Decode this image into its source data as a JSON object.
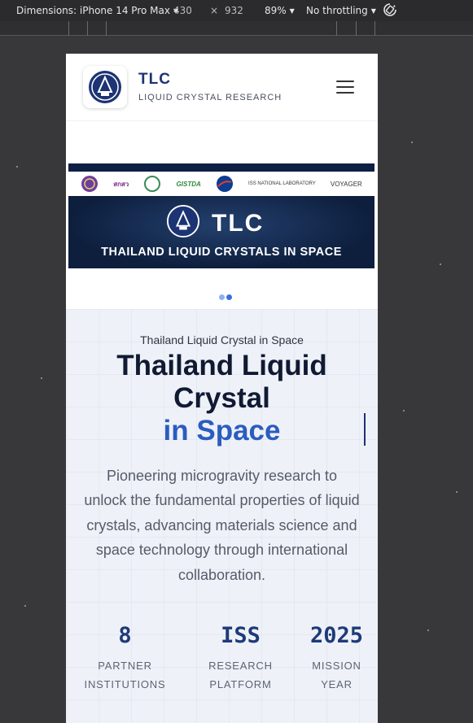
{
  "devtools": {
    "dimensions_label": "Dimensions: iPhone 14 Pro Max",
    "width": "430",
    "times": "×",
    "height": "932",
    "zoom": "89%",
    "throttling": "No throttling"
  },
  "header": {
    "brand_title": "TLC",
    "brand_subtitle": "LIQUID CRYSTAL RESEARCH",
    "menu_icon": "hamburger-icon"
  },
  "carousel": {
    "partners": [
      "สกสว",
      "GISTDA",
      "NASA",
      "ISS NATIONAL LABORATORY",
      "VOYAGER"
    ],
    "banner_title": "TLC",
    "banner_caption": "THAILAND LIQUID CRYSTALS IN SPACE",
    "slides": 2,
    "active_slide": 2
  },
  "hero": {
    "eyebrow": "Thailand Liquid Crystal in Space",
    "headline_line1": "Thailand Liquid",
    "headline_line2": "Crystal",
    "headline_accent": "in Space",
    "lead": "Pioneering microgravity research to unlock the fundamental properties of liquid crystals, advancing materials science and space technology through international collaboration."
  },
  "stats": [
    {
      "value": "8",
      "label_line1": "PARTNER",
      "label_line2": "INSTITUTIONS"
    },
    {
      "value": "ISS",
      "label_line1": "RESEARCH",
      "label_line2": "PLATFORM"
    },
    {
      "value": "2025",
      "label_line1": "MISSION",
      "label_line2": "YEAR"
    }
  ],
  "colors": {
    "brand_navy": "#1c3473",
    "accent_blue": "#2b5cbf",
    "hero_bg": "#eef1f7"
  }
}
